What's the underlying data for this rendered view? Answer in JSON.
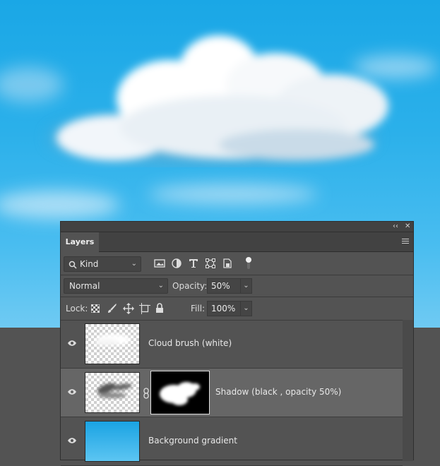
{
  "panel": {
    "collapse_glyph": "‹‹",
    "close_glyph": "✕",
    "tab_label": "Layers",
    "menu_icon": "hamburger-menu-icon"
  },
  "filter": {
    "kind_label": "Kind",
    "kind_icon": "search-icon",
    "icons": [
      "image-filter-icon",
      "adjustment-filter-icon",
      "type-filter-icon",
      "shape-filter-icon",
      "smart-object-filter-icon"
    ],
    "toggle_icon": "filter-toggle-icon"
  },
  "blend": {
    "mode": "Normal",
    "opacity_label": "Opacity:",
    "opacity_value": "50%"
  },
  "lock": {
    "label": "Lock:",
    "icons": [
      "lock-transparent-pixels-icon",
      "lock-image-pixels-icon",
      "lock-position-icon",
      "artboard-nesting-icon",
      "lock-all-icon"
    ],
    "fill_label": "Fill:",
    "fill_value": "100%"
  },
  "layers": [
    {
      "name": "Cloud brush (white)",
      "visible": true,
      "selected": false,
      "has_mask": false
    },
    {
      "name": "Shadow (black , opacity 50%)",
      "visible": true,
      "selected": true,
      "has_mask": true
    },
    {
      "name": "Background gradient",
      "visible": true,
      "selected": false,
      "has_mask": false
    }
  ],
  "colors": {
    "panel_bg": "#535353",
    "selected_row": "#666666",
    "sky_top": "#1aa7e6",
    "sky_bottom": "#6fcaf3"
  }
}
